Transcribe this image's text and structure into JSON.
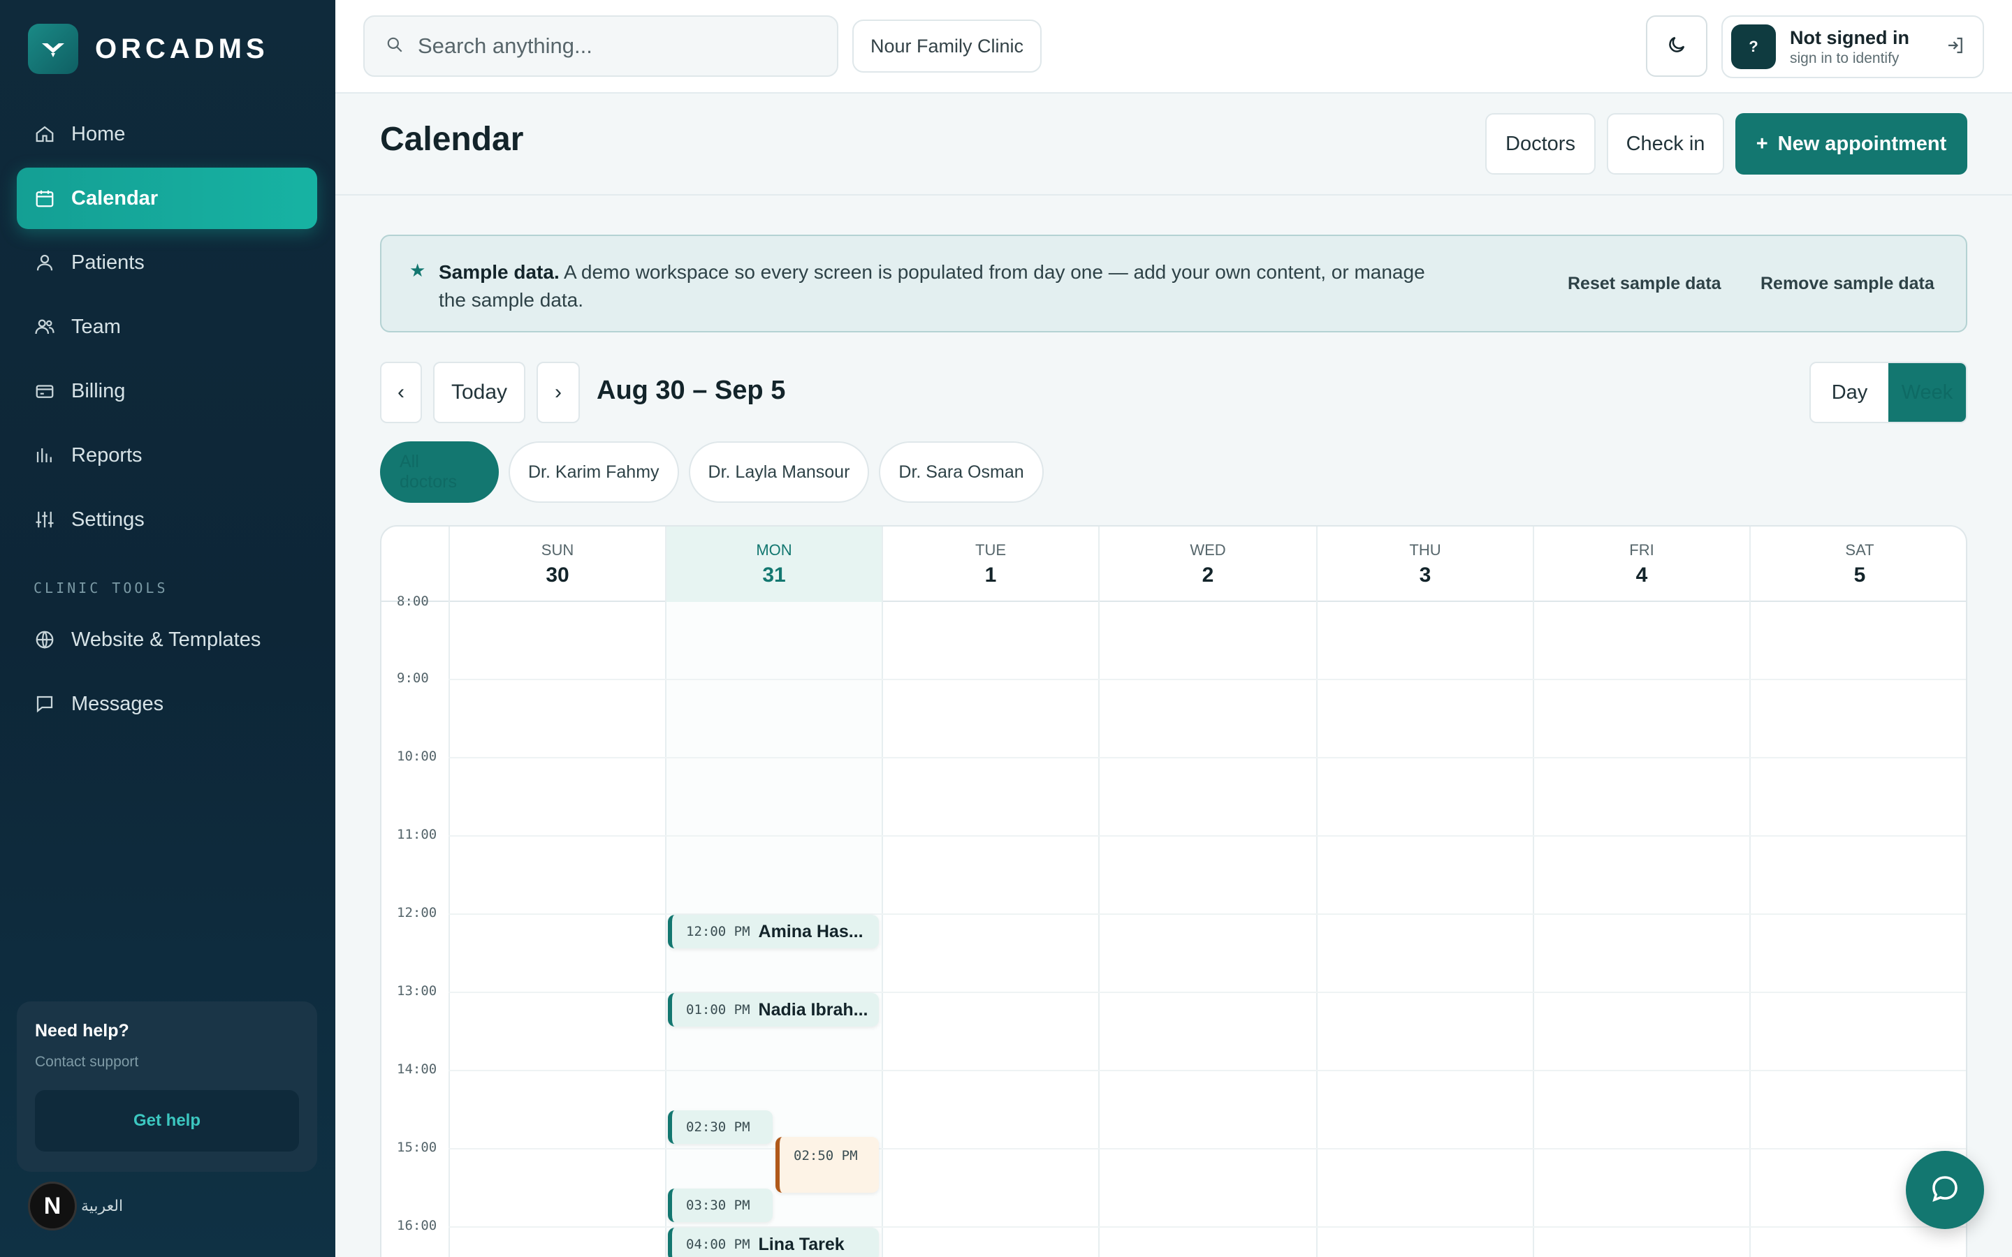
{
  "brand": {
    "name": "ORCADMS"
  },
  "sidebar": {
    "items": [
      {
        "label": "Home",
        "icon": "home-icon"
      },
      {
        "label": "Calendar",
        "icon": "calendar-icon",
        "active": true
      },
      {
        "label": "Patients",
        "icon": "user-icon"
      },
      {
        "label": "Team",
        "icon": "users-icon"
      },
      {
        "label": "Billing",
        "icon": "credit-card-icon"
      },
      {
        "label": "Reports",
        "icon": "bar-chart-icon"
      },
      {
        "label": "Settings",
        "icon": "sliders-icon"
      }
    ],
    "section_label": "CLINIC TOOLS",
    "tools": [
      {
        "label": "Website & Templates",
        "icon": "globe-icon"
      },
      {
        "label": "Messages",
        "icon": "message-icon"
      }
    ],
    "help": {
      "title": "Need help?",
      "subtitle": "Contact support",
      "button": "Get help"
    },
    "language": {
      "avatar": "N",
      "label": "العربية"
    }
  },
  "topbar": {
    "search_placeholder": "Search anything...",
    "clinic": "Nour Family Clinic",
    "user": {
      "avatar": "?",
      "name": "Not signed in",
      "sub": "sign in to identify"
    }
  },
  "page": {
    "title": "Calendar",
    "buttons": {
      "doctors": "Doctors",
      "checkin": "Check in",
      "new_appointment": "New appointment",
      "new_prefix": "+"
    }
  },
  "banner": {
    "bold": "Sample data.",
    "text": "A demo workspace so every screen is populated from day one — add your own content, or manage the sample data.",
    "reset": "Reset sample data",
    "remove": "Remove sample data"
  },
  "controls": {
    "prev": "‹",
    "today": "Today",
    "next": "›",
    "range": "Aug 30 – Sep 5",
    "views": {
      "day": "Day",
      "week": "Week",
      "selected": "Week"
    }
  },
  "doctor_filters": [
    "All doctors",
    "Dr. Karim Fahmy",
    "Dr. Layla Mansour",
    "Dr. Sara Osman"
  ],
  "calendar": {
    "days": [
      {
        "name": "SUN",
        "num": "30"
      },
      {
        "name": "MON",
        "num": "31",
        "today": true
      },
      {
        "name": "TUE",
        "num": "1"
      },
      {
        "name": "WED",
        "num": "2"
      },
      {
        "name": "THU",
        "num": "3"
      },
      {
        "name": "FRI",
        "num": "4"
      },
      {
        "name": "SAT",
        "num": "5"
      }
    ],
    "hours": [
      "8:00",
      "9:00",
      "10:00",
      "11:00",
      "12:00",
      "13:00",
      "14:00",
      "15:00",
      "16:00"
    ],
    "appointments": [
      {
        "time": "12:00 PM",
        "name": "Amina Has..."
      },
      {
        "time": "01:00 PM",
        "name": "Nadia Ibrah..."
      },
      {
        "time": "02:30 PM",
        "name": ""
      },
      {
        "time": "02:50 PM",
        "name": ""
      },
      {
        "time": "03:30 PM",
        "name": ""
      },
      {
        "time": "04:00 PM",
        "name": "Lina Tarek"
      }
    ]
  },
  "colors": {
    "accent": "#137770",
    "sidebar": "#0f2a3b",
    "warning": "#b0591a"
  }
}
